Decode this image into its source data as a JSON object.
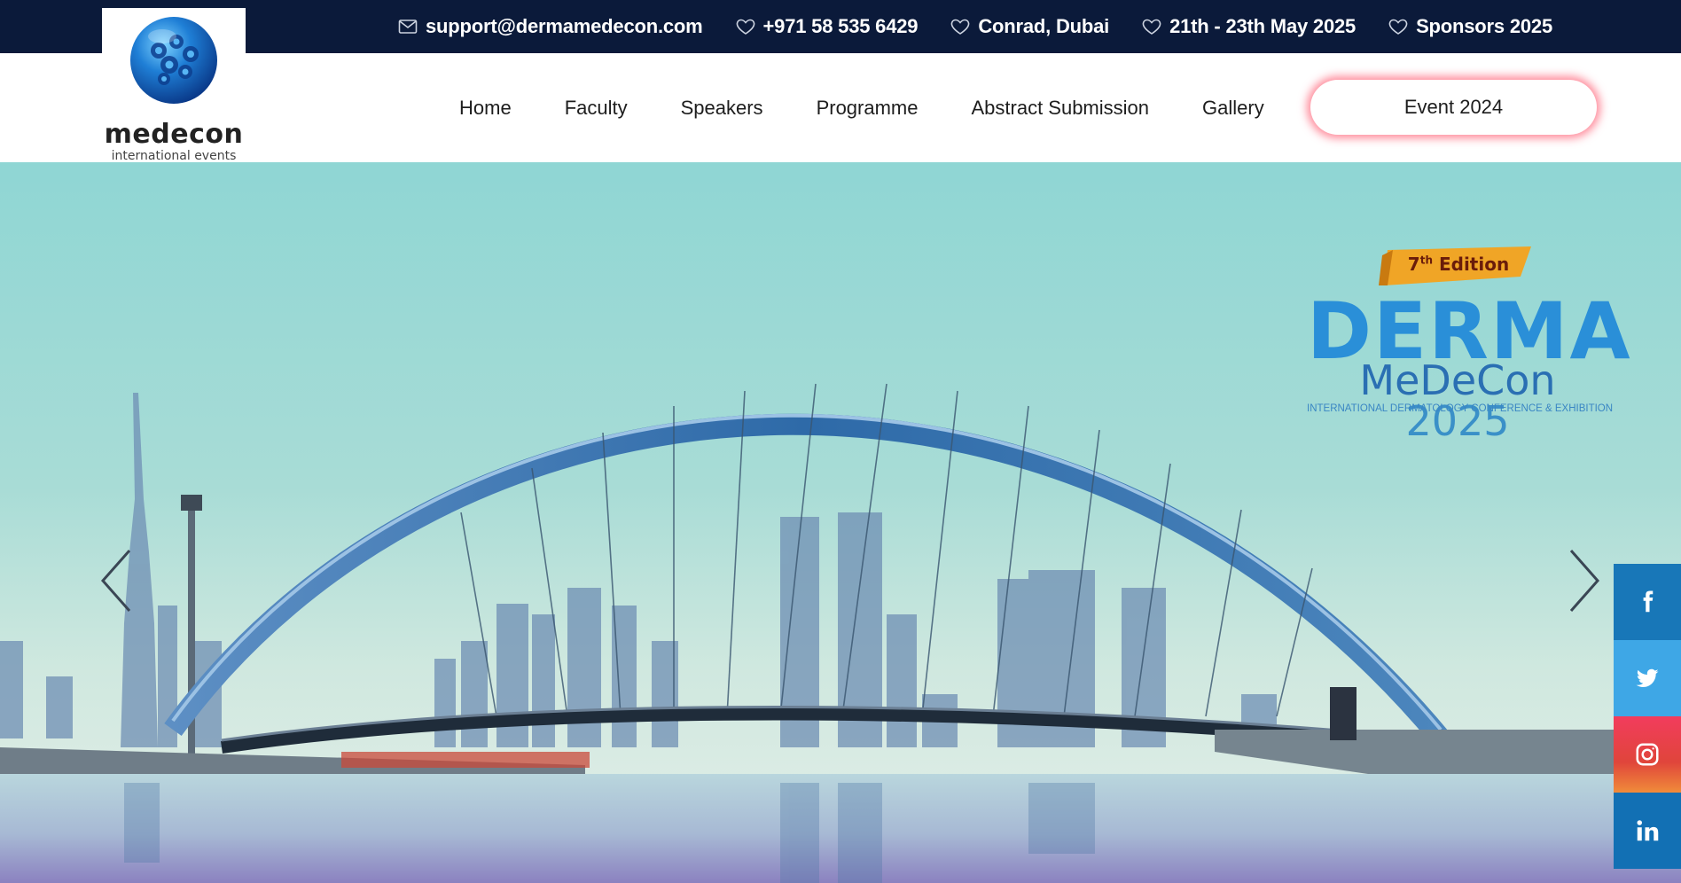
{
  "topbar": {
    "email": "support@dermamedecon.com",
    "phone": "+971 58 535 6429",
    "venue": "Conrad, Dubai",
    "dates": "21th - 23th May 2025",
    "sponsors": "Sponsors 2025"
  },
  "logo": {
    "wordmark": "medecon",
    "subtitle": "international events"
  },
  "nav": {
    "items": [
      {
        "label": "Home"
      },
      {
        "label": "Faculty"
      },
      {
        "label": "Speakers"
      },
      {
        "label": "Programme"
      },
      {
        "label": "Abstract Submission"
      },
      {
        "label": "Gallery"
      }
    ],
    "cta_label": "Event 2024"
  },
  "hero": {
    "edition_number": "7",
    "edition_suffix": "th",
    "edition_word": "Edition",
    "title": "DERMA",
    "subtitle_name": "MeDeCon",
    "subtitle_year": "2025",
    "tagline": "INTERNATIONAL DERMATOLOGY CONFERENCE & EXHIBITION"
  },
  "icons": {
    "email": "envelope-icon",
    "topbar_bullets": "heart-icon",
    "prev": "chevron-left-icon",
    "next": "chevron-right-icon",
    "social": [
      "facebook-icon",
      "twitter-icon",
      "instagram-icon",
      "linkedin-icon"
    ]
  },
  "colors": {
    "topbar_bg": "#0b1a3a",
    "cta_glow": "#ff4b64",
    "derma_blue": "#2a8fd8",
    "facebook": "#1877b8",
    "twitter": "#3ea7e6",
    "instagram": "#f23c5d",
    "linkedin": "#1270b4"
  }
}
